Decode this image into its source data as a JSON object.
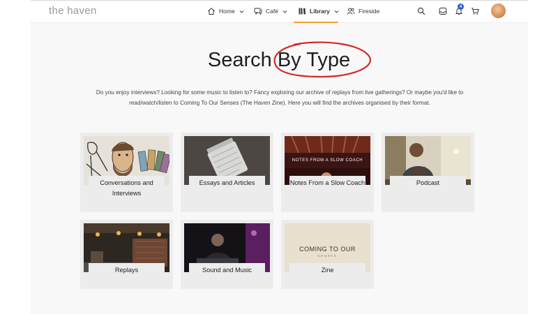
{
  "header": {
    "logo": "the haven",
    "nav": [
      {
        "label": "Home",
        "icon": "home-icon"
      },
      {
        "label": "Café",
        "icon": "chat-icon"
      },
      {
        "label": "Library",
        "icon": "books-icon"
      },
      {
        "label": "Fireside",
        "icon": "people-icon"
      }
    ],
    "active_nav": "Library",
    "accent_color": "#f0a030",
    "notifications_count": "4",
    "badge_color": "#2a5cd6",
    "tools": [
      "search-icon",
      "inbox-icon",
      "bell-icon",
      "cart-icon"
    ]
  },
  "main": {
    "title": "Search By Type",
    "intro": "Do you enjoy interviews? Looking for some music to listen to? Fancy exploring our archive of replays from live gatherings? Or maybe you'd like to read/watch/listen to Coming To Our Senses (The Haven Zine). Here you will find the archives organised by their format.",
    "cards": [
      {
        "label": "Conversations and Interviews"
      },
      {
        "label": "Essays and Articles"
      },
      {
        "label": "Notes From a Slow Coach",
        "thumb_text": "NOTES FROM A SLOW COACH"
      },
      {
        "label": "Podcast"
      },
      {
        "label": "Replays"
      },
      {
        "label": "Sound and Music"
      },
      {
        "label": "Zine",
        "thumb_text": "COMING TO OUR",
        "thumb_subtext": "SENSES"
      }
    ],
    "annotation_color": "#d42a2a"
  }
}
